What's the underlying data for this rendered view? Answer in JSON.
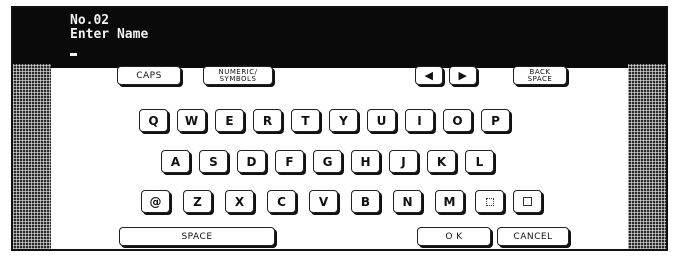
{
  "display": {
    "line1": "No.02",
    "line2": "Enter Name"
  },
  "controls": {
    "caps": "CAPS",
    "numeric_symbols": "NUMERIC/\nSYMBOLS",
    "left_arrow": "◀",
    "right_arrow": "▶",
    "back_space": "BACK\nSPACE"
  },
  "rows": {
    "row1": [
      "Q",
      "W",
      "E",
      "R",
      "T",
      "Y",
      "U",
      "I",
      "O",
      "P"
    ],
    "row2": [
      "A",
      "S",
      "D",
      "F",
      "G",
      "H",
      "J",
      "K",
      "L"
    ],
    "row3": [
      "@",
      "Z",
      "X",
      "C",
      "V",
      "B",
      "N",
      "M"
    ]
  },
  "bottom": {
    "space": "SPACE",
    "ok": "O K",
    "cancel": "CANCEL"
  },
  "icons": {
    "half_space_key": "dotted-square-icon",
    "full_space_key": "square-icon"
  }
}
